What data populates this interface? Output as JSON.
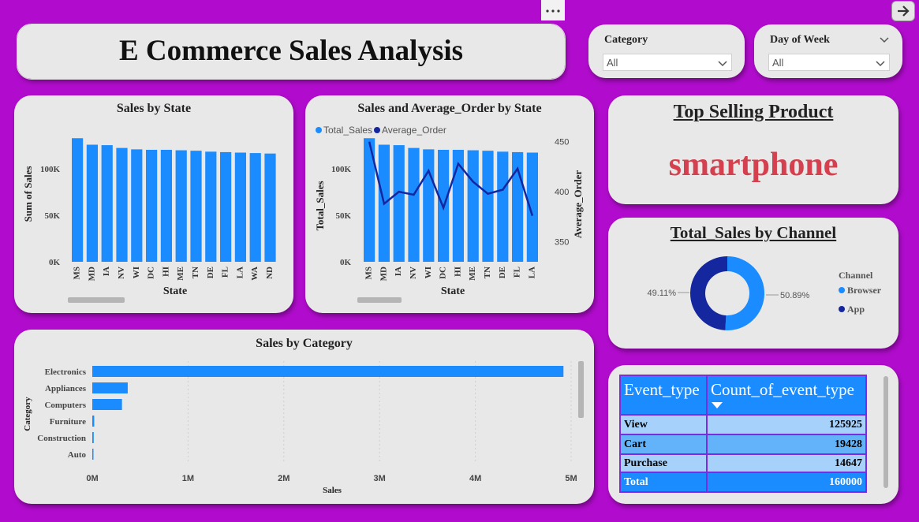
{
  "header": {
    "title": "E Commerce Sales Analysis",
    "more_icon": "more-options-icon",
    "nav_icon": "arrow-right-icon"
  },
  "slicers": {
    "category": {
      "label": "Category",
      "value": "All"
    },
    "day_of_week": {
      "label": "Day of Week",
      "value": "All"
    }
  },
  "top_product": {
    "title": "Top Selling Product",
    "value": "smartphone"
  },
  "colors": {
    "background": "#b10ccd",
    "card": "#e8e8e8",
    "bar": "#1a8cff",
    "line": "#14279e",
    "top_product": "#d4404e"
  },
  "chart_data": [
    {
      "type": "bar",
      "title": "Sales by State",
      "xlabel": "State",
      "ylabel": "Sum of Sales",
      "categories": [
        "MS",
        "MD",
        "IA",
        "NV",
        "WI",
        "DC",
        "HI",
        "ME",
        "TN",
        "DE",
        "FL",
        "LA",
        "WA",
        "ND"
      ],
      "values": [
        133000,
        126000,
        125500,
        122500,
        121000,
        120500,
        120500,
        120000,
        119500,
        118500,
        118000,
        117500,
        117000,
        116500
      ],
      "yticks": [
        "0K",
        "50K",
        "100K"
      ],
      "ylim": [
        0,
        140000
      ]
    },
    {
      "type": "bar",
      "title": "Sales and Average_Order by State",
      "xlabel": "State",
      "ylabel": "Total_Sales",
      "y2label": "Average_Order",
      "legend": [
        "Total_Sales",
        "Average_Order"
      ],
      "categories": [
        "MS",
        "MD",
        "IA",
        "NV",
        "WI",
        "DC",
        "HI",
        "ME",
        "TN",
        "DE",
        "FL",
        "LA"
      ],
      "series": [
        {
          "name": "Total_Sales",
          "values": [
            133000,
            126000,
            125500,
            122500,
            121000,
            120500,
            120500,
            120000,
            119500,
            118500,
            118000,
            117500
          ]
        },
        {
          "name": "Average_Order",
          "values": [
            450,
            388,
            400,
            397,
            421,
            384,
            428,
            410,
            398,
            402,
            423,
            376
          ]
        }
      ],
      "yticks": [
        "0K",
        "50K",
        "100K"
      ],
      "y2ticks": [
        "350",
        "400",
        "450"
      ],
      "ylim": [
        0,
        140000
      ],
      "y2lim": [
        330,
        460
      ]
    },
    {
      "type": "pie",
      "title": "Total_Sales by Channel",
      "legend_title": "Channel",
      "labels": [
        "Browser",
        "App"
      ],
      "values": [
        50.89,
        49.11
      ],
      "value_labels": [
        "50.89%",
        "49.11%"
      ]
    },
    {
      "type": "bar",
      "title": "Sales by Category",
      "xlabel": "Sales",
      "ylabel": "Category",
      "categories": [
        "Electronics",
        "Appliances",
        "Computers",
        "Furniture",
        "Construction",
        "Auto"
      ],
      "values": [
        4920000,
        370000,
        310000,
        20000,
        15000,
        10000
      ],
      "xticks": [
        "0M",
        "1M",
        "2M",
        "3M",
        "4M",
        "5M"
      ],
      "xlim": [
        0,
        5000000
      ]
    },
    {
      "type": "table",
      "columns": [
        "Event_type",
        "Count_of_event_type"
      ],
      "rows": [
        [
          "View",
          "125925"
        ],
        [
          "Cart",
          "19428"
        ],
        [
          "Purchase",
          "14647"
        ]
      ],
      "total": [
        "Total",
        "160000"
      ]
    }
  ]
}
